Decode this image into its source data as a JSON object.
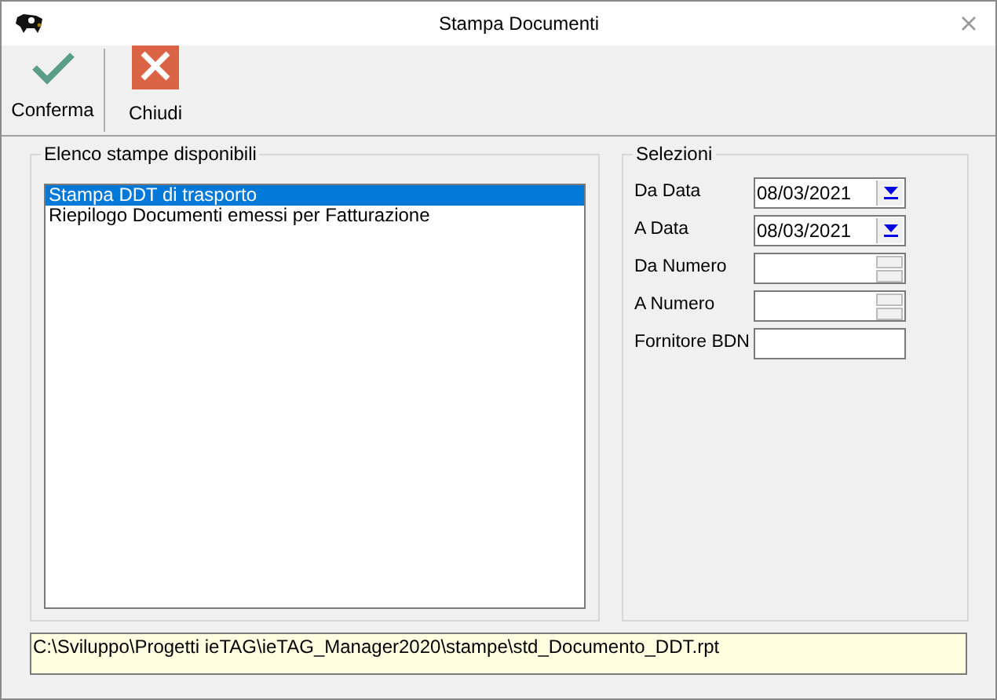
{
  "window": {
    "title": "Stampa Documenti"
  },
  "toolbar": [
    {
      "kind": "confirm",
      "label": "Conferma"
    },
    {
      "kind": "close",
      "label": "Chiudi"
    }
  ],
  "reports": {
    "title": "Elenco stampe disponibili",
    "items": [
      {
        "label": "Stampa DDT di trasporto",
        "selected": true
      },
      {
        "label": "Riepilogo Documenti emessi per Fatturazione",
        "selected": false
      }
    ]
  },
  "selections": {
    "title": "Selezioni",
    "fields": [
      {
        "kind": "date",
        "label": "Da Data",
        "value": "08/03/2021"
      },
      {
        "kind": "date",
        "label": "A Data",
        "value": "08/03/2021"
      },
      {
        "kind": "spin",
        "label": "Da Numero"
      },
      {
        "kind": "spin",
        "label": "A Numero"
      },
      {
        "kind": "text",
        "label": "Fornitore BDN"
      }
    ]
  },
  "status_path": "C:\\Sviluppo\\Progetti ieTAG\\ieTAG_Manager2020\\stampe\\std_Documento_DDT.rpt"
}
